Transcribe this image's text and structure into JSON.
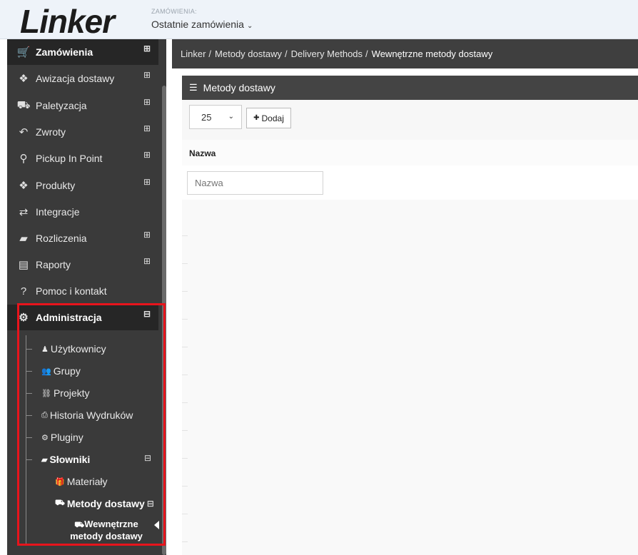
{
  "header": {
    "logo_text": "Linker",
    "context_label": "ZAMÓWIENIA:",
    "context_value": "Ostatnie zamówienia",
    "context_chevron": "⌄"
  },
  "sidebar": {
    "items": [
      {
        "label": "Zamówienia",
        "icon": "cart-icon",
        "glyph": "🛒",
        "expandable": true
      },
      {
        "label": "Awizacja dostawy",
        "icon": "boxes-icon",
        "glyph": "❖",
        "expandable": true
      },
      {
        "label": "Paletyzacja",
        "icon": "truck-icon",
        "glyph": "⛟",
        "expandable": true
      },
      {
        "label": "Zwroty",
        "icon": "return-icon",
        "glyph": "↶",
        "expandable": true
      },
      {
        "label": "Pickup In Point",
        "icon": "map-pin-icon",
        "glyph": "⚲",
        "expandable": true
      },
      {
        "label": "Produkty",
        "icon": "boxes-icon",
        "glyph": "❖",
        "expandable": true
      },
      {
        "label": "Integracje",
        "icon": "exchange-icon",
        "glyph": "⇄",
        "expandable": false
      },
      {
        "label": "Rozliczenia",
        "icon": "book-icon",
        "glyph": "▰",
        "expandable": true
      },
      {
        "label": "Raporty",
        "icon": "document-icon",
        "glyph": "▤",
        "expandable": true
      },
      {
        "label": "Pomoc i kontakt",
        "icon": "question-icon",
        "glyph": "?",
        "expandable": false
      },
      {
        "label": "Administracja",
        "icon": "cogs-icon",
        "glyph": "⚙",
        "expandable": true
      }
    ],
    "expand_glyph": "⊞",
    "collapse_glyph": "⊟",
    "admin_sub": [
      {
        "label": "Użytkownicy",
        "icon": "user-icon",
        "glyph": "♟"
      },
      {
        "label": "Grupy",
        "icon": "users-icon",
        "glyph": "👥"
      },
      {
        "label": "Projekty",
        "icon": "sitemap-icon",
        "glyph": "⛓"
      },
      {
        "label": "Historia Wydruków",
        "icon": "print-icon",
        "glyph": "⎙"
      },
      {
        "label": "Pluginy",
        "icon": "cogs-icon",
        "glyph": "⚙"
      },
      {
        "label": "Słowniki",
        "icon": "book-icon",
        "glyph": "▰"
      }
    ],
    "dict_sub": [
      {
        "label": "Materiały",
        "icon": "gift-icon",
        "glyph": "🎁"
      },
      {
        "label": "Metody dostawy",
        "icon": "truck-icon",
        "glyph": "⛟"
      }
    ],
    "methods_sub": {
      "label_line1": "Wewnętrzne",
      "label_line2": "metody dostawy",
      "glyph": "⛟"
    }
  },
  "breadcrumb": {
    "items": [
      "Linker",
      "Metody dostawy",
      "Delivery Methods"
    ],
    "separator": "/",
    "current": "Wewnętrzne metody dostawy"
  },
  "panel": {
    "title": "Metody dostawy",
    "title_glyph": "☰",
    "page_size": "25",
    "page_size_chevron": "⌄",
    "add_label": "Dodaj",
    "add_glyph": "✚",
    "column_name": "Nazwa",
    "filter_placeholder": "Nazwa"
  },
  "colors": {
    "highlight": "#e8141c",
    "sidebar_bg": "#3a3a3a",
    "header_bg": "#eef3f9"
  }
}
